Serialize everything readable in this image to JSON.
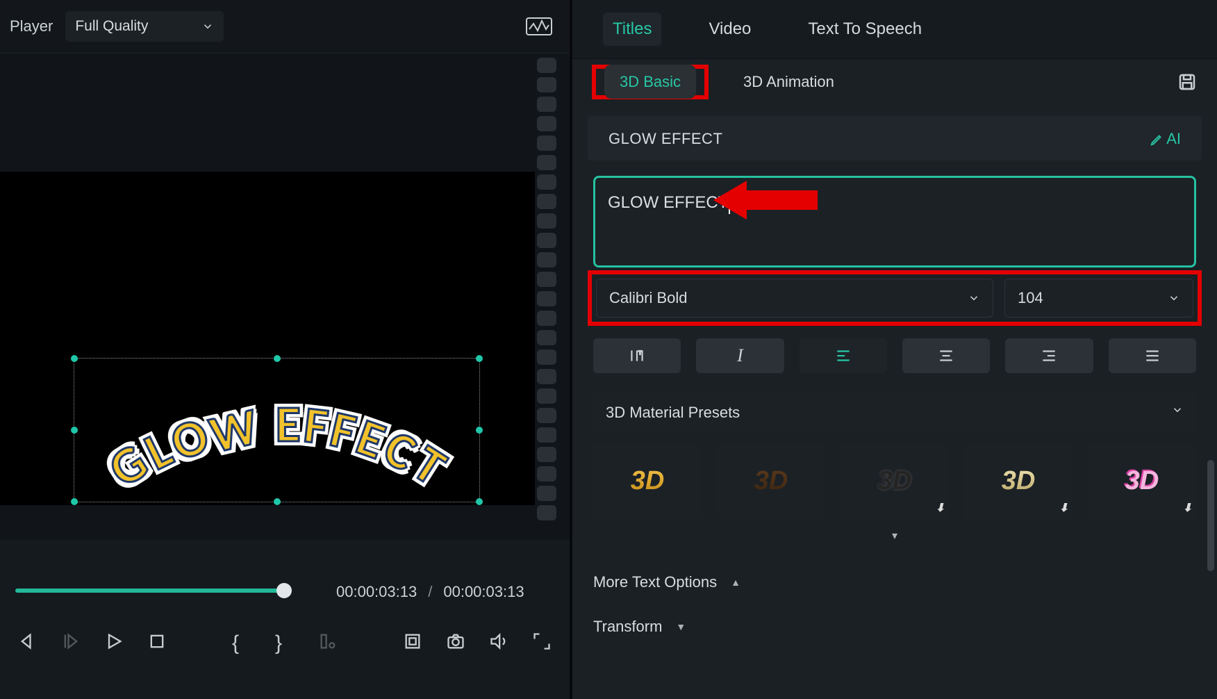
{
  "player": {
    "label": "Player",
    "quality": "Full Quality",
    "preview_text": "GLOW EFFECT",
    "current_time": "00:00:03:13",
    "total_time": "00:00:03:13"
  },
  "tabs": {
    "titles": "Titles",
    "video": "Video",
    "tts": "Text To Speech"
  },
  "subtabs": {
    "basic": "3D Basic",
    "anim": "3D Animation"
  },
  "section": {
    "title": "GLOW EFFECT"
  },
  "text_input": {
    "value": "GLOW EFFECT"
  },
  "font": {
    "family": "Calibri Bold",
    "size": "104"
  },
  "presets": {
    "header": "3D Material Presets",
    "items": [
      "3D",
      "3D",
      "3D",
      "3D",
      "3D"
    ]
  },
  "more_options": "More Text Options",
  "transform": "Transform",
  "ai_label": "AI",
  "arrow_annotation": "red arrow pointing left at the text input field",
  "highlight_annotations": [
    "red box around 3D Basic subtab",
    "red box around font family and size dropdowns"
  ]
}
